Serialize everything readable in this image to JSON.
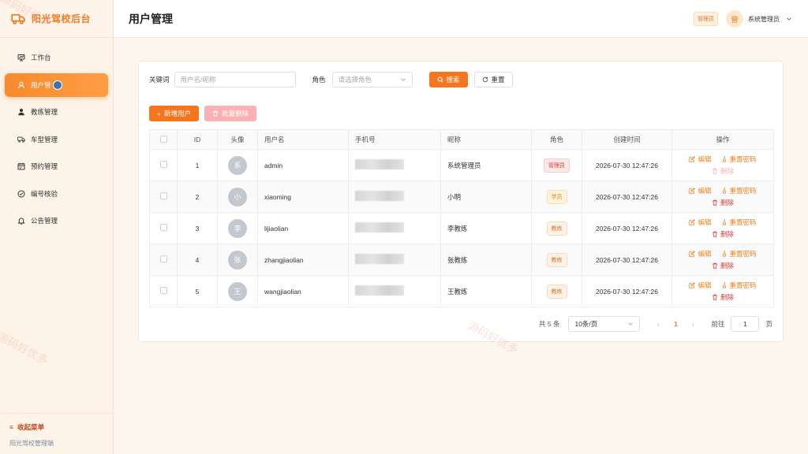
{
  "brand": {
    "name": "阳光驾校后台"
  },
  "sidebar": {
    "items": [
      {
        "label": "工作台",
        "icon": "dashboard-icon"
      },
      {
        "label": "用户管",
        "icon": "user-icon",
        "active": true
      },
      {
        "label": "教练管理",
        "icon": "coach-icon"
      },
      {
        "label": "车型管理",
        "icon": "truck-icon"
      },
      {
        "label": "预约管理",
        "icon": "calendar-icon"
      },
      {
        "label": "编号核验",
        "icon": "check-circle-icon"
      },
      {
        "label": "公告管理",
        "icon": "bell-icon"
      }
    ],
    "collapse_label": "收起菜单",
    "footer": "阳光驾校管理端"
  },
  "header": {
    "title": "用户管理",
    "role_tag": "管理员",
    "avatar_char": "管",
    "user_name": "系统管理员"
  },
  "search": {
    "keyword_label": "关键词",
    "keyword_placeholder": "用户名/昵称",
    "role_label": "角色",
    "role_placeholder": "请选择角色",
    "search_button": "搜索",
    "reset_button": "重置"
  },
  "actions": {
    "add_button": "新增用户",
    "batch_delete_button": "批量删除"
  },
  "table": {
    "columns": [
      "ID",
      "头像",
      "用户名",
      "手机号",
      "昵称",
      "角色",
      "创建时间",
      "操作"
    ],
    "rows": [
      {
        "id": "1",
        "avatar": "系",
        "username": "admin",
        "nickname": "系统管理员",
        "role": "管理员",
        "role_type": "admin",
        "created": "2026-07-30 12:47:26",
        "delete_disabled": true
      },
      {
        "id": "2",
        "avatar": "小",
        "username": "xiaoming",
        "nickname": "小明",
        "role": "学员",
        "role_type": "student",
        "created": "2026-07-30 12:47:26",
        "delete_disabled": false
      },
      {
        "id": "3",
        "avatar": "李",
        "username": "lijiaolian",
        "nickname": "李教练",
        "role": "教练",
        "role_type": "coach",
        "created": "2026-07-30 12:47:26",
        "delete_disabled": false
      },
      {
        "id": "4",
        "avatar": "张",
        "username": "zhangjiaolian",
        "nickname": "张教练",
        "role": "教练",
        "role_type": "coach",
        "created": "2026-07-30 12:47:26",
        "delete_disabled": false
      },
      {
        "id": "5",
        "avatar": "王",
        "username": "wangjiaolian",
        "nickname": "王教练",
        "role": "教练",
        "role_type": "coach",
        "created": "2026-07-30 12:47:26",
        "delete_disabled": false
      }
    ],
    "op_edit": "编辑",
    "op_reset_pwd": "重置密码",
    "op_delete": "删除"
  },
  "pagination": {
    "total_text": "共 5 条",
    "page_size": "10条/页",
    "current_page": "1",
    "goto_label": "前往",
    "goto_value": "1",
    "page_unit": "页"
  },
  "watermarks": [
    "源码好优多",
    "源码好优多",
    "源码好优多"
  ],
  "colors": {
    "accent": "#f5761f",
    "danger": "#e03b3b",
    "background": "#fdf6ef"
  }
}
